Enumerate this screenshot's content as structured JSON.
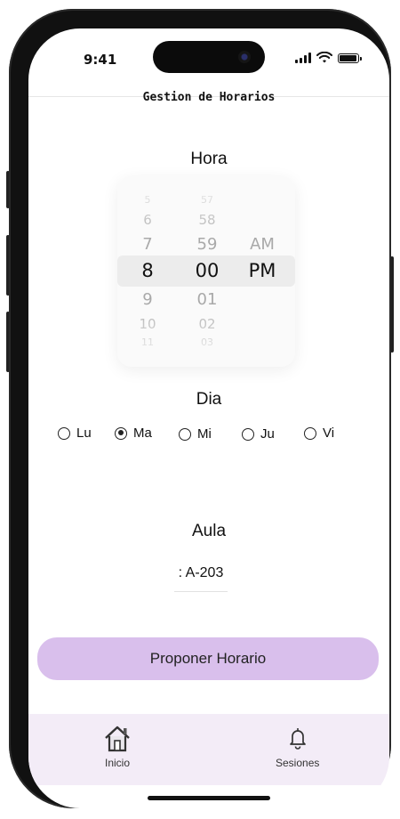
{
  "status_bar": {
    "time": "9:41"
  },
  "header": {
    "title": "Gestion de Horarios"
  },
  "hora": {
    "label": "Hora",
    "hours": [
      "5",
      "6",
      "7",
      "8",
      "9",
      "10",
      "11"
    ],
    "minutes": [
      "57",
      "58",
      "59",
      "00",
      "01",
      "02",
      "03"
    ],
    "periods": [
      "AM",
      "PM"
    ],
    "selected": {
      "hour": "8",
      "minute": "00",
      "period": "PM"
    }
  },
  "dia": {
    "label": "Dia",
    "options": [
      {
        "label": "Lu",
        "checked": false
      },
      {
        "label": "Ma",
        "checked": true
      },
      {
        "label": "Mi",
        "checked": false
      },
      {
        "label": "Ju",
        "checked": false
      },
      {
        "label": "Vi",
        "checked": false
      }
    ]
  },
  "aula": {
    "label": "Aula",
    "value": ": A-203"
  },
  "actions": {
    "propose_label": "Proponer Horario"
  },
  "bottom_nav": {
    "items": [
      {
        "label": "Inicio",
        "icon": "home-icon"
      },
      {
        "label": "Sesiones",
        "icon": "bell-icon"
      }
    ]
  },
  "colors": {
    "accent": "#d9bfec",
    "nav_bg": "#f3ecf7"
  }
}
